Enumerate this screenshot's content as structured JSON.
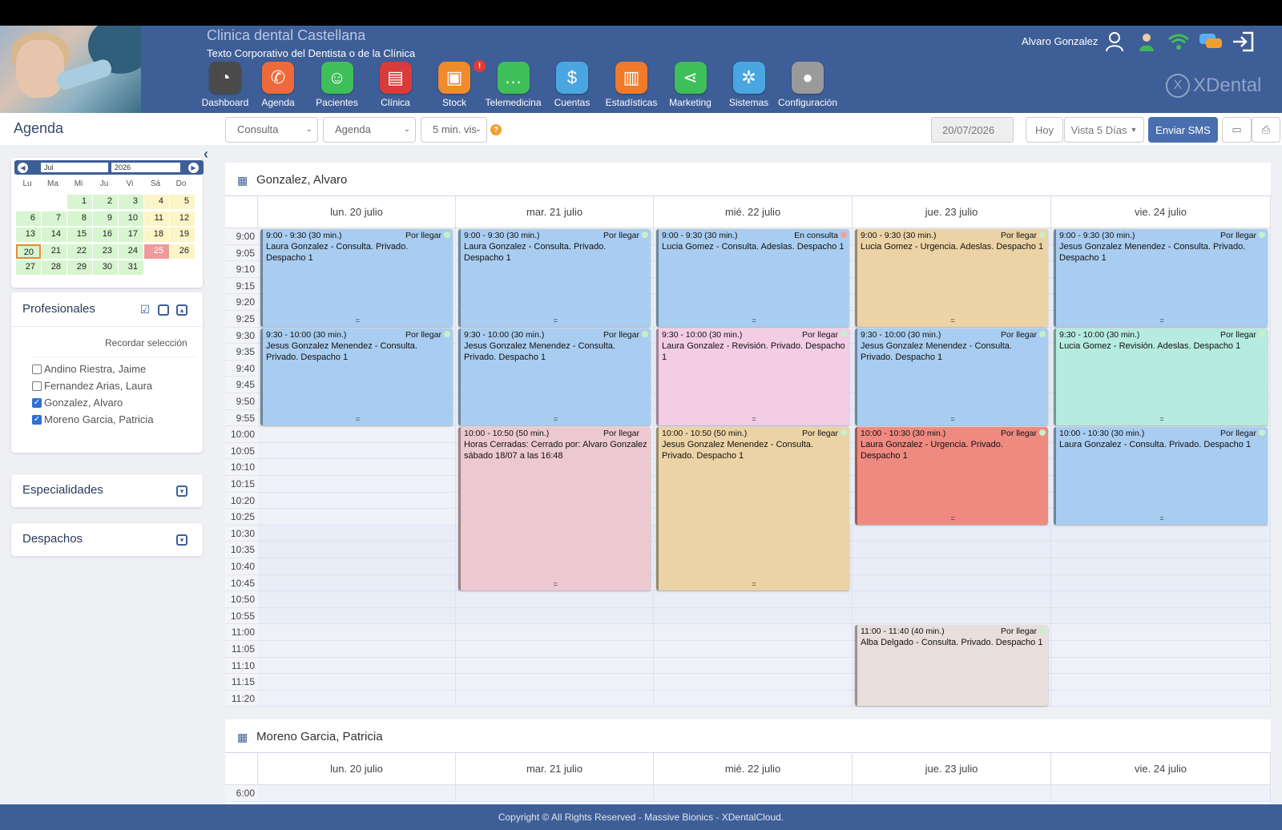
{
  "header": {
    "clinic_name": "Clinica dental Castellana",
    "clinic_subtitle": "Texto Corporativo del Dentista o de la Clínica",
    "user_name": "Alvaro Gonzalez",
    "brand": "XDental",
    "menu": [
      {
        "label": "Dashboard",
        "icon": "gauge-icon",
        "color": "#4a4a4a",
        "glyph": "◔"
      },
      {
        "label": "Agenda",
        "icon": "phone-icon",
        "color": "#ef6a3a",
        "glyph": "✆"
      },
      {
        "label": "Pacientes",
        "icon": "patient-icon",
        "color": "#3fbf5a",
        "glyph": "☺"
      },
      {
        "label": "Clínica",
        "icon": "clipboard-icon",
        "color": "#d93a3a",
        "glyph": "▤"
      },
      {
        "label": "Stock",
        "icon": "box-icon",
        "color": "#f08a2a",
        "glyph": "▣",
        "badge": "!"
      },
      {
        "label": "Telemedicina",
        "icon": "chat-icon",
        "color": "#3fbf5a",
        "glyph": "…"
      },
      {
        "label": "Cuentas",
        "icon": "money-hand-icon",
        "color": "#4aa6e0",
        "glyph": "$"
      },
      {
        "label": "Estadísticas",
        "icon": "bar-chart-icon",
        "color": "#f07a2a",
        "glyph": "▥"
      },
      {
        "label": "Marketing",
        "icon": "share-icon",
        "color": "#3fbf5a",
        "glyph": "⋖"
      },
      {
        "label": "Sistemas",
        "icon": "gear-wheel-icon",
        "color": "#4aa6e0",
        "glyph": "✲"
      },
      {
        "label": "Configuración",
        "icon": "user-settings-icon",
        "color": "#9a9a9a",
        "glyph": "●"
      }
    ]
  },
  "toolbar": {
    "title": "Agenda",
    "consulta": "Consulta",
    "agenda": "Agenda",
    "interval": "5 min. vis",
    "help": "?",
    "date": "20/07/2026",
    "today": "Hoy",
    "view": "Vista 5 Días",
    "sms": "Enviar SMS"
  },
  "mini_calendar": {
    "month": "Jul",
    "year": "2026",
    "dow": [
      "Lu",
      "Ma",
      "Mi",
      "Ju",
      "Vi",
      "Sá",
      "Do"
    ],
    "weeks": [
      [
        "",
        "",
        "1",
        "2",
        "3",
        "4",
        "5"
      ],
      [
        "6",
        "7",
        "8",
        "9",
        "10",
        "11",
        "12"
      ],
      [
        "13",
        "14",
        "15",
        "16",
        "17",
        "18",
        "19"
      ],
      [
        "20",
        "21",
        "22",
        "23",
        "24",
        "25",
        "26"
      ],
      [
        "27",
        "28",
        "29",
        "30",
        "31",
        "",
        ""
      ]
    ],
    "selected": "20",
    "holiday": "25"
  },
  "sidebar": {
    "profesionales_title": "Profesionales",
    "remember": "Recordar selección",
    "professionals": [
      {
        "name": "Andino Riestra, Jaime",
        "checked": false
      },
      {
        "name": "Fernandez Arias, Laura",
        "checked": false
      },
      {
        "name": "Gonzalez, Alvaro",
        "checked": true
      },
      {
        "name": "Moreno Garcia, Patricia",
        "checked": true
      }
    ],
    "especialidades_title": "Especialidades",
    "despachos_title": "Despachos"
  },
  "agenda1": {
    "name": "Gonzalez, Alvaro",
    "days": [
      "lun. 20 julio",
      "mar. 21 julio",
      "mié. 22 julio",
      "jue. 23 julio",
      "vie. 24 julio"
    ],
    "times": [
      "9:00",
      "9:05",
      "9:10",
      "9:15",
      "9:20",
      "9:25",
      "9:30",
      "9:35",
      "9:40",
      "9:45",
      "9:50",
      "9:55",
      "10:00",
      "10:05",
      "10:10",
      "10:15",
      "10:20",
      "10:25",
      "10:30",
      "10:35",
      "10:40",
      "10:45",
      "10:50",
      "10:55",
      "11:00",
      "11:05",
      "11:10",
      "11:15",
      "11:20"
    ],
    "appointments": [
      {
        "day": 0,
        "start": 0,
        "slots": 6,
        "color": "#a9cdf0",
        "time": "9:00 - 9:30 (30 min.)",
        "status": "Por llegar",
        "dot": "#c8f0c8",
        "desc": "Laura Gonzalez - Consulta. Privado. Despacho 1"
      },
      {
        "day": 1,
        "start": 0,
        "slots": 6,
        "color": "#a9cdf0",
        "time": "9:00 - 9:30 (30 min.)",
        "status": "Por llegar",
        "dot": "#c8f0c8",
        "desc": "Laura Gonzalez - Consulta. Privado. Despacho 1"
      },
      {
        "day": 2,
        "start": 0,
        "slots": 6,
        "color": "#a9cdf0",
        "time": "9:00 - 9:30 (30 min.)",
        "status": "En consulta",
        "dot": "#f0a0a0",
        "desc": "Lucia Gomez - Consulta. Adeslas. Despacho 1"
      },
      {
        "day": 3,
        "start": 0,
        "slots": 6,
        "color": "#ecd3a6",
        "time": "9:00 - 9:30 (30 min.)",
        "status": "Por llegar",
        "dot": "#c8f0c8",
        "desc": "Lucia Gomez - Urgencia. Adeslas. Despacho 1"
      },
      {
        "day": 4,
        "start": 0,
        "slots": 6,
        "color": "#a9cdf0",
        "time": "9:00 - 9:30 (30 min.)",
        "status": "Por llegar",
        "dot": "#c8f0c8",
        "desc": "Jesus Gonzalez Menendez - Consulta. Privado. Despacho 1"
      },
      {
        "day": 0,
        "start": 6,
        "slots": 6,
        "color": "#a9cdf0",
        "time": "9:30 - 10:00 (30 min.)",
        "status": "Por llegar",
        "dot": "#c8f0c8",
        "desc": "Jesus Gonzalez Menendez - Consulta. Privado. Despacho 1"
      },
      {
        "day": 1,
        "start": 6,
        "slots": 6,
        "color": "#a9cdf0",
        "time": "9:30 - 10:00 (30 min.)",
        "status": "Por llegar",
        "dot": "#c8f0c8",
        "desc": "Jesus Gonzalez Menendez - Consulta. Privado. Despacho 1"
      },
      {
        "day": 2,
        "start": 6,
        "slots": 6,
        "color": "#f3cce6",
        "time": "9:30 - 10:00 (30 min.)",
        "status": "Por llegar",
        "dot": "#c8f0c8",
        "desc": "Laura Gonzalez - Revisión. Privado. Despacho 1"
      },
      {
        "day": 3,
        "start": 6,
        "slots": 6,
        "color": "#a9cdf0",
        "time": "9:30 - 10:00 (30 min.)",
        "status": "Por llegar",
        "dot": "#c8f0c8",
        "desc": "Jesus Gonzalez Menendez - Consulta. Privado. Despacho 1"
      },
      {
        "day": 4,
        "start": 6,
        "slots": 6,
        "color": "#b5ecdf",
        "time": "9:30 - 10:00 (30 min.)",
        "status": "Por llegar",
        "dot": "#c8f0c8",
        "desc": "Lucia Gomez - Revisión. Adeslas. Despacho 1"
      },
      {
        "day": 1,
        "start": 12,
        "slots": 10,
        "color": "#ecc9d0",
        "time": "10:00 - 10:50 (50 min.)",
        "status": "Por llegar",
        "dot": "",
        "desc": "Horas Cerradas: Cerrado por: Alvaro Gonzalez sábado 18/07 a las 16:48"
      },
      {
        "day": 2,
        "start": 12,
        "slots": 10,
        "color": "#ecd3a6",
        "time": "10:00 - 10:50 (50 min.)",
        "status": "Por llegar",
        "dot": "#c8f0c8",
        "desc": "Jesus Gonzalez Menendez - Consulta. Privado. Despacho 1"
      },
      {
        "day": 3,
        "start": 12,
        "slots": 6,
        "color": "#ef8a80",
        "time": "10:00 - 10:30 (30 min.)",
        "status": "Por llegar",
        "dot": "#c8f0c8",
        "desc": "Laura Gonzalez - Urgencia. Privado. Despacho 1"
      },
      {
        "day": 4,
        "start": 12,
        "slots": 6,
        "color": "#a9cdf0",
        "time": "10:00 - 10:30 (30 min.)",
        "status": "Por llegar",
        "dot": "#c8f0c8",
        "desc": "Laura Gonzalez - Consulta. Privado. Despacho 1"
      },
      {
        "day": 3,
        "start": 24,
        "slots": 5,
        "color": "#e8dfdc",
        "time": "11:00 - 11:40 (40 min.)",
        "status": "Por llegar",
        "dot": "#c8f0c8",
        "desc": "Alba Delgado - Consulta. Privado. Despacho 1",
        "nogrip": true
      }
    ]
  },
  "agenda2": {
    "name": "Moreno Garcia, Patricia",
    "days": [
      "lun. 20 julio",
      "mar. 21 julio",
      "mié. 22 julio",
      "jue. 23 julio",
      "vie. 24 julio"
    ],
    "times": [
      "6:00"
    ]
  },
  "footer": {
    "text": "Copyright © All Rights Reserved - Massive Bionics - XDentalCloud."
  }
}
